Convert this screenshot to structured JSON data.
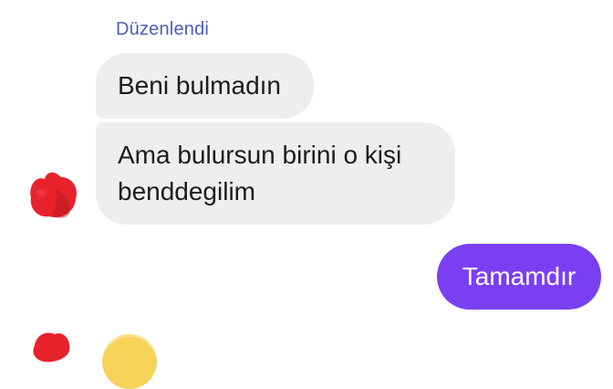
{
  "conversation": {
    "edited_label": "Düzenlendi",
    "messages": [
      {
        "direction": "incoming",
        "text": "Beni bulmadın"
      },
      {
        "direction": "incoming",
        "text": "Ama bulursun birini o kişi\nbenddegilim"
      },
      {
        "direction": "outgoing",
        "text": "Tamamdır"
      }
    ],
    "colors": {
      "incoming_bubble": "#eeeeee",
      "outgoing_bubble": "#7b3ff2",
      "edited_label": "#4a5fb5",
      "avatar_redaction": "#e8222a"
    },
    "icons": {
      "sender_avatar": "redacted-avatar",
      "partial_emoji": "emoji"
    }
  }
}
